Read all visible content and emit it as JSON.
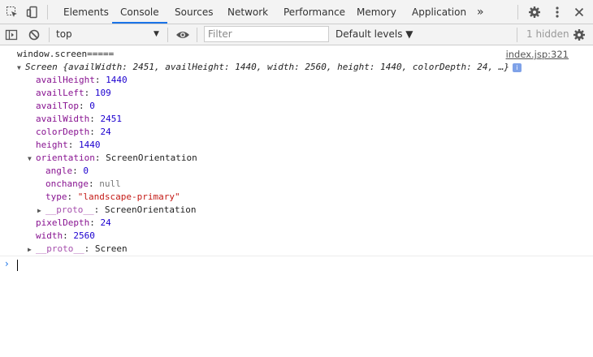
{
  "tabs": [
    {
      "label": "Elements",
      "active": false
    },
    {
      "label": "Console",
      "active": true
    },
    {
      "label": "Sources",
      "active": false
    },
    {
      "label": "Network",
      "active": false
    },
    {
      "label": "Performance",
      "active": false
    },
    {
      "label": "Memory",
      "active": false
    },
    {
      "label": "Application",
      "active": false
    }
  ],
  "more_tabs_label": "»",
  "toolbar": {
    "context": "top",
    "filter_placeholder": "Filter",
    "levels": "Default levels ▼",
    "hidden": "1 hidden"
  },
  "colors": {
    "accent": "#1a73e8",
    "property": "#881391",
    "number": "#1c00cf",
    "string": "#c41a16"
  },
  "console": {
    "log_text": "window.screen=====",
    "log_source": "index.jsp:321",
    "summary": {
      "class": "Screen",
      "preview": "{availWidth: 2451, availHeight: 1440, width: 2560, height: 1440, colorDepth: 24, …}"
    },
    "props": [
      {
        "name": "availHeight",
        "value": "1440"
      },
      {
        "name": "availLeft",
        "value": "109"
      },
      {
        "name": "availTop",
        "value": "0"
      },
      {
        "name": "availWidth",
        "value": "2451"
      },
      {
        "name": "colorDepth",
        "value": "24"
      },
      {
        "name": "height",
        "value": "1440"
      }
    ],
    "orientation": {
      "name": "orientation",
      "type": "ScreenOrientation",
      "children": [
        {
          "name": "angle",
          "value": "0"
        },
        {
          "name": "onchange",
          "value": "null"
        },
        {
          "name": "type",
          "value": "\"landscape-primary\""
        }
      ],
      "proto": {
        "name": "__proto__",
        "value": "ScreenOrientation"
      }
    },
    "props_after": [
      {
        "name": "pixelDepth",
        "value": "24"
      },
      {
        "name": "width",
        "value": "2560"
      }
    ],
    "proto": {
      "name": "__proto__",
      "value": "Screen"
    }
  }
}
